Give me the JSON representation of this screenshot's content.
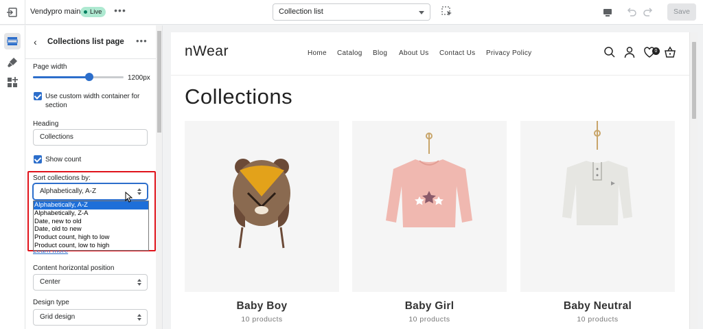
{
  "topbar": {
    "store_name": "Vendypro main",
    "status_badge": "Live",
    "page_selector_value": "Collection list",
    "save_label": "Save"
  },
  "panel": {
    "title": "Collections list page",
    "page_width_label": "Page width",
    "page_width_value": "1200px",
    "page_width_fraction": 0.62,
    "custom_width_checked": true,
    "custom_width_label": "Use custom width container for section",
    "heading_label": "Heading",
    "heading_value": "Collections",
    "show_count_checked": true,
    "show_count_label": "Show count",
    "sort_label": "Sort collections by:",
    "sort_value": "Alphabetically, A-Z",
    "sort_options": [
      "Alphabetically, A-Z",
      "Alphabetically, Z-A",
      "Date, new to old",
      "Date, old to new",
      "Product count, high to low",
      "Product count, low to high"
    ],
    "sort_selected_index": 0,
    "learn_more": "Learn more",
    "content_pos_label": "Content horizontal position",
    "content_pos_value": "Center",
    "design_type_label": "Design type",
    "design_type_value": "Grid design"
  },
  "preview": {
    "logo": "nWear",
    "nav": [
      "Home",
      "Catalog",
      "Blog",
      "About Us",
      "Contact Us",
      "Privacy Policy"
    ],
    "cart_count": "0",
    "page_title": "Collections",
    "collections": [
      {
        "name": "Baby Boy",
        "count": "10 products"
      },
      {
        "name": "Baby Girl",
        "count": "10 products"
      },
      {
        "name": "Baby Neutral",
        "count": "10 products"
      }
    ]
  },
  "colors": {
    "accent": "#2c6ecb",
    "live_badge": "#aee9d1",
    "highlight": "#e0121a"
  }
}
